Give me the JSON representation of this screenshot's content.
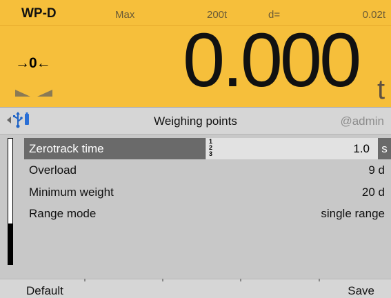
{
  "display": {
    "scale_id": "WP-D",
    "max_label": "Max",
    "max_value": "200t",
    "d_label": "d=",
    "d_value": "0.02t",
    "zero_indicator": "→0←",
    "weight": "0.000",
    "unit": "t",
    "background_color": "#f6bf3b"
  },
  "title_bar": {
    "title": "Weighing points",
    "user": "@admin",
    "icons": [
      "back-arrow-icon",
      "usb-icon"
    ]
  },
  "list": {
    "items": [
      {
        "label": "Zerotrack time",
        "value": "1.0",
        "unit": "s",
        "input_mode": [
          "1",
          "2",
          "3"
        ]
      },
      {
        "label": "Overload",
        "value": "9 d"
      },
      {
        "label": "Minimum weight",
        "value": "20 d"
      },
      {
        "label": "Range mode",
        "value": "single range"
      }
    ]
  },
  "softkeys": {
    "left": "Default",
    "right": "Save"
  }
}
